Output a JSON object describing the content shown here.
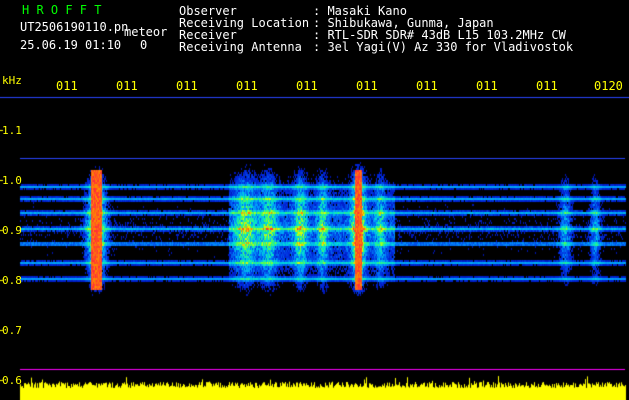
{
  "header": {
    "app_name": "H R O F F T",
    "filename": "UT2506190110.pn",
    "mode": "meteor",
    "datetime": "25.06.19 01:10",
    "counter": "0",
    "info_labels": [
      "Observer",
      "Receiving Location",
      "Receiver",
      "Receiving Antenna"
    ],
    "info_values": [
      ": Masaki Kano",
      ": Shibukawa, Gunma, Japan",
      ": RTL-SDR SDR# 43dB L15 103.2MHz CW",
      ": 3el Yagi(V) Az 330 for Vladivostok"
    ]
  },
  "axis": {
    "unit_label": "kHz",
    "freq_ticks": [
      "1.1",
      "1.0",
      "0.9",
      "0.8",
      "0.7",
      "0.6"
    ],
    "time_ticks": [
      "011",
      "011",
      "011",
      "011",
      "011",
      "011",
      "011",
      "011",
      "011",
      "0120"
    ]
  },
  "colors": {
    "background": "#000000",
    "app_name": "#00ff00",
    "text": "#ffffff",
    "axis_label": "#ffff00",
    "audio_level": "#ffff00",
    "baseline": "#ff00ff"
  }
}
